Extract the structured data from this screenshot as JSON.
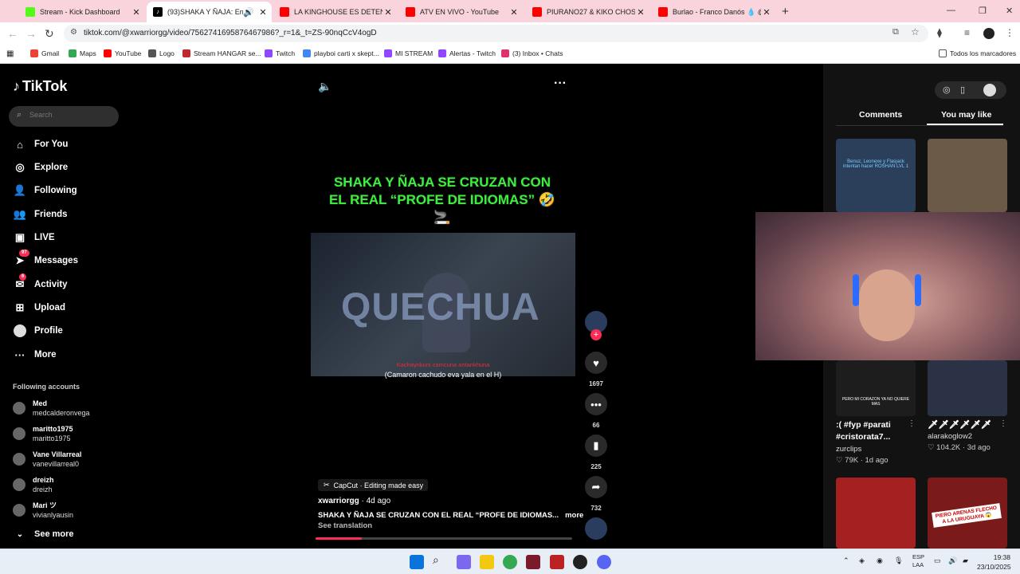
{
  "browser": {
    "tabs": [
      {
        "title": "Stream - Kick Dashboard",
        "color": "#53fc18",
        "active": false
      },
      {
        "title": "(93)SHAKA Y ÑAJA: Encuentro",
        "color": "#000000",
        "active": true
      },
      {
        "title": "LA KINGHOUSE ES DETENIDA E",
        "color": "#ff0000",
        "active": false
      },
      {
        "title": "ATV EN VIVO - YouTube",
        "color": "#ff0000",
        "active": false
      },
      {
        "title": "PIURANO27 & KIKO CHOSICA",
        "color": "#ff0000",
        "active": false
      },
      {
        "title": "Burlao - Franco Danós 💧 @No",
        "color": "#ff0000",
        "active": false
      }
    ],
    "url": "tiktok.com/@xwarriorgg/video/7562741695876467986?_r=1&_t=ZS-90nqCcV4ogD",
    "bookmarks": [
      {
        "label": "Gmail",
        "color": "#ea4335"
      },
      {
        "label": "Maps",
        "color": "#34a853"
      },
      {
        "label": "YouTube",
        "color": "#ff0000"
      },
      {
        "label": "Logo",
        "color": "#555555"
      },
      {
        "label": "Stream HANGAR se...",
        "color": "#c1272d"
      },
      {
        "label": "Twitch",
        "color": "#9146ff"
      },
      {
        "label": "playboi carti x skept...",
        "color": "#4285f4"
      },
      {
        "label": "MI STREAM",
        "color": "#9146ff"
      },
      {
        "label": "Alertas - Twitch",
        "color": "#9146ff"
      },
      {
        "label": "(3) Inbox • Chats",
        "color": "#e1306c"
      }
    ],
    "all_bookmarks": "Todos los marcadores"
  },
  "tiktok": {
    "brand": "TikTok",
    "search_placeholder": "Search",
    "nav": [
      {
        "label": "For You",
        "icon": "home-icon",
        "badge": ""
      },
      {
        "label": "Explore",
        "icon": "compass-icon",
        "badge": ""
      },
      {
        "label": "Following",
        "icon": "following-icon",
        "badge": ""
      },
      {
        "label": "Friends",
        "icon": "friends-icon",
        "badge": ""
      },
      {
        "label": "LIVE",
        "icon": "live-icon",
        "badge": ""
      },
      {
        "label": "Messages",
        "icon": "messages-icon",
        "badge": "97"
      },
      {
        "label": "Activity",
        "icon": "activity-icon",
        "badge": "6"
      },
      {
        "label": "Upload",
        "icon": "upload-icon",
        "badge": ""
      },
      {
        "label": "Profile",
        "icon": "profile-icon",
        "badge": ""
      },
      {
        "label": "More",
        "icon": "more-dots-icon",
        "badge": ""
      }
    ],
    "following_title": "Following accounts",
    "following": [
      {
        "name": "Med",
        "handle": "medcalderonvega"
      },
      {
        "name": "maritto1975",
        "handle": "maritto1975"
      },
      {
        "name": "Vane Villarreal",
        "handle": "vanevillarreal0"
      },
      {
        "name": "dreizh",
        "handle": "dreizh"
      },
      {
        "name": "Mari ツ",
        "handle": "vivianlyausin"
      }
    ],
    "see_more": "See more"
  },
  "video": {
    "caption": "SHAKA Y ÑAJA SE CRUZAN CON EL REAL “PROFE DE IDIOMAS” 🤣 🚬",
    "overlay_word": "QUECHUA",
    "subtitle_1": "Kachaynkuni camcuna antankhuna",
    "subtitle_2": "(Camaron cachudo eva yala en el H)",
    "likes": "1697",
    "comments": "66",
    "saves": "225",
    "shares": "732",
    "capcut": "CapCut · Editing made easy",
    "author": "xwarriorgg",
    "posted": "· 4d ago",
    "description": "SHAKA Y ÑAJA SE CRUZAN CON EL REAL “PROFE DE IDIOMAS...",
    "more": "more",
    "see_translation": "See translation",
    "progress": 0.18
  },
  "right_panel": {
    "tabs": [
      "Comments",
      "You may like"
    ],
    "active_tab": "You may like",
    "cards": [
      {
        "title": ":( #fyp #parati #cristorata7...",
        "user": "zurclips",
        "stats": "♡ 79K · 1d ago"
      },
      {
        "title": "🗡🗡🗡🗡🗡🗡",
        "user": "alarakoglow2",
        "stats": "♡ 104.2K · 3d ago"
      }
    ],
    "thumb_texts": [
      "Benuz, Leonexe y Flasjack intentan hacer ROSHAN LVL 1",
      "PERO MI CORAZON YA NO QUIERE MAS",
      "PIERO ARENAS FLECHO A LA URUGUAYA 😱"
    ]
  },
  "taskbar": {
    "lang": "ESP",
    "lang2": "LAA",
    "time": "19:38",
    "date": "23/10/2025"
  }
}
